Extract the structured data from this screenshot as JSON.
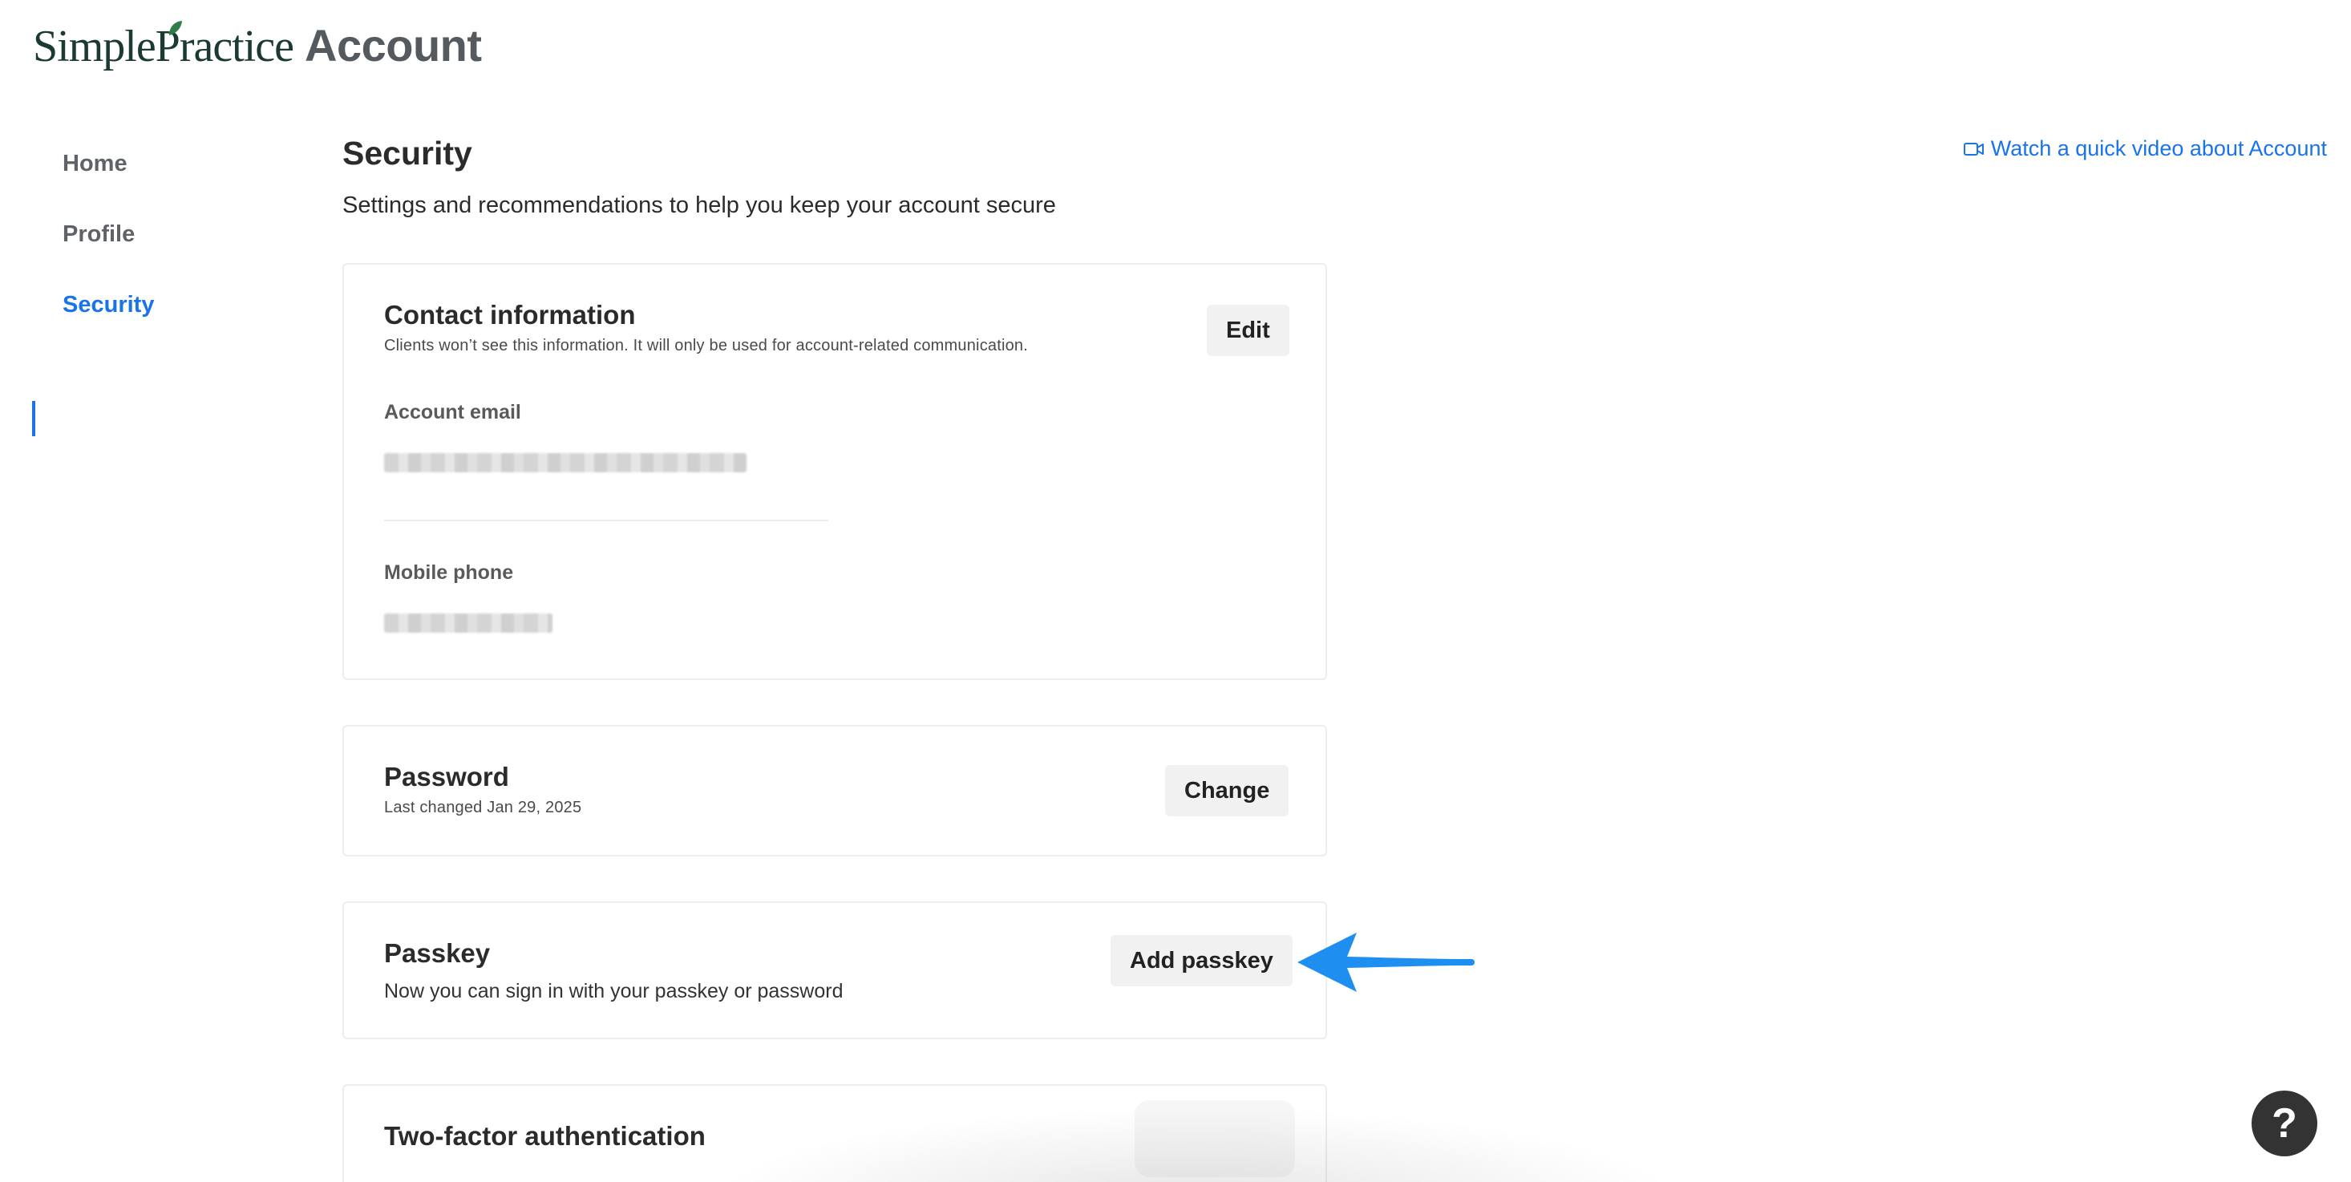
{
  "header": {
    "brand": "SimplePractice",
    "product": "Account"
  },
  "sidebar": {
    "items": [
      {
        "label": "Home",
        "active": false
      },
      {
        "label": "Profile",
        "active": false
      },
      {
        "label": "Security",
        "active": true
      }
    ]
  },
  "top_link": {
    "label": "Watch a quick video about Account",
    "icon": "video-camera-icon"
  },
  "main": {
    "title": "Security",
    "subtitle": "Settings and recommendations to help you keep your account secure",
    "contact": {
      "title": "Contact information",
      "note": "Clients won’t see this information. It will only be used for account-related communication.",
      "edit_label": "Edit",
      "email_label": "Account email",
      "phone_label": "Mobile phone"
    },
    "password": {
      "title": "Password",
      "last_changed": "Last changed Jan 29, 2025",
      "change_label": "Change"
    },
    "passkey": {
      "title": "Passkey",
      "description": "Now you can sign in with your passkey or password",
      "add_label": "Add passkey"
    },
    "two_factor": {
      "title": "Two-factor authentication"
    }
  },
  "help": {
    "label": "?"
  },
  "colors": {
    "accent": "#1a73e8",
    "brand_green": "#1b3a34",
    "annotation_arrow": "#1e8ff0"
  }
}
